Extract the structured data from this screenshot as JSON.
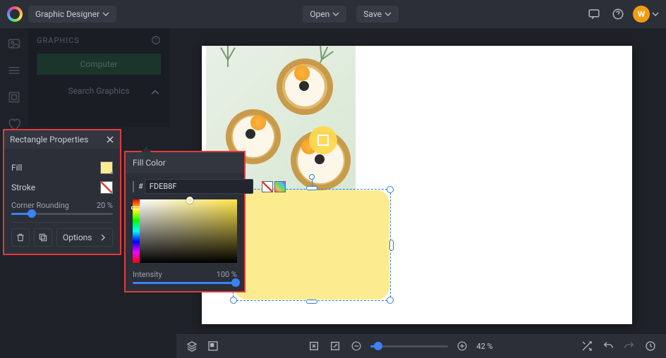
{
  "topbar": {
    "mode": "Graphic Designer",
    "open": "Open",
    "save": "Save",
    "avatar_initial": "W"
  },
  "left_panel": {
    "title": "GRAPHICS",
    "computer_btn": "Computer",
    "search_placeholder": "Search Graphics"
  },
  "rect_props": {
    "title": "Rectangle Properties",
    "fill_label": "Fill",
    "stroke_label": "Stroke",
    "corner_label": "Corner Rounding",
    "corner_value": "20 %",
    "options_label": "Options"
  },
  "fill_color": {
    "title": "Fill Color",
    "hex_prefix": "#",
    "hex_value": "FDEB8F",
    "intensity_label": "Intensity",
    "intensity_value": "100 %"
  },
  "colors": {
    "fill_swatch": "#FDEB8F",
    "selection_rect": "#FDEB8F",
    "accent": "#3b82f6",
    "highlight_border": "#e23b3b"
  },
  "bottombar": {
    "zoom_pct": "42 %"
  },
  "icons": {
    "chat": "chat-icon",
    "help": "help-icon",
    "chevron_down": "chevron-down-icon"
  }
}
